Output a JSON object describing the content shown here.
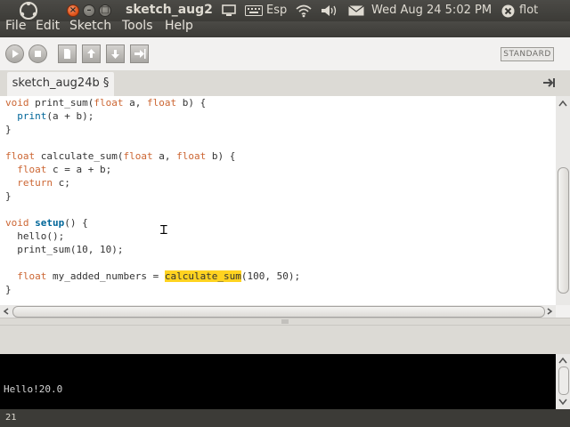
{
  "topbar": {
    "window_title": "sketch_aug2",
    "keyboard_layout": "Esp",
    "datetime": "Wed Aug 24  5:02 PM",
    "user": "flot",
    "window_controls": {
      "close": "×",
      "minimize": "–",
      "maximize": "□"
    }
  },
  "menubar": {
    "items": [
      "File",
      "Edit",
      "Sketch",
      "Tools",
      "Help"
    ]
  },
  "toolbar": {
    "buttons": [
      {
        "name": "run",
        "icon": "play-icon"
      },
      {
        "name": "stop",
        "icon": "stop-icon"
      },
      {
        "name": "new",
        "icon": "new-file-icon"
      },
      {
        "name": "open",
        "icon": "open-arrow-up-icon"
      },
      {
        "name": "save",
        "icon": "save-arrow-down-icon"
      },
      {
        "name": "export",
        "icon": "export-arrow-right-icon"
      }
    ],
    "mode": "STANDARD"
  },
  "tabs": {
    "active": "sketch_aug24b §"
  },
  "editor": {
    "lines": [
      "void print_sum(float a, float b) {",
      "  print(a + b);",
      "}",
      "",
      "float calculate_sum(float a, float b) {",
      "  float c = a + b;",
      "  return c;",
      "}",
      "",
      "void setup() {",
      "  hello();",
      "  print_sum(10, 10);",
      "",
      "  float my_added_numbers = calculate_sum(100, 50);",
      "}"
    ],
    "highlighted_token": "calculate_sum"
  },
  "console": {
    "output": "Hello!20.0"
  },
  "status": {
    "line_number": "21"
  },
  "colors": {
    "keyword": "#cc6633",
    "function": "#006699",
    "highlight": "#ffd320",
    "panel": "#3c3b37"
  }
}
